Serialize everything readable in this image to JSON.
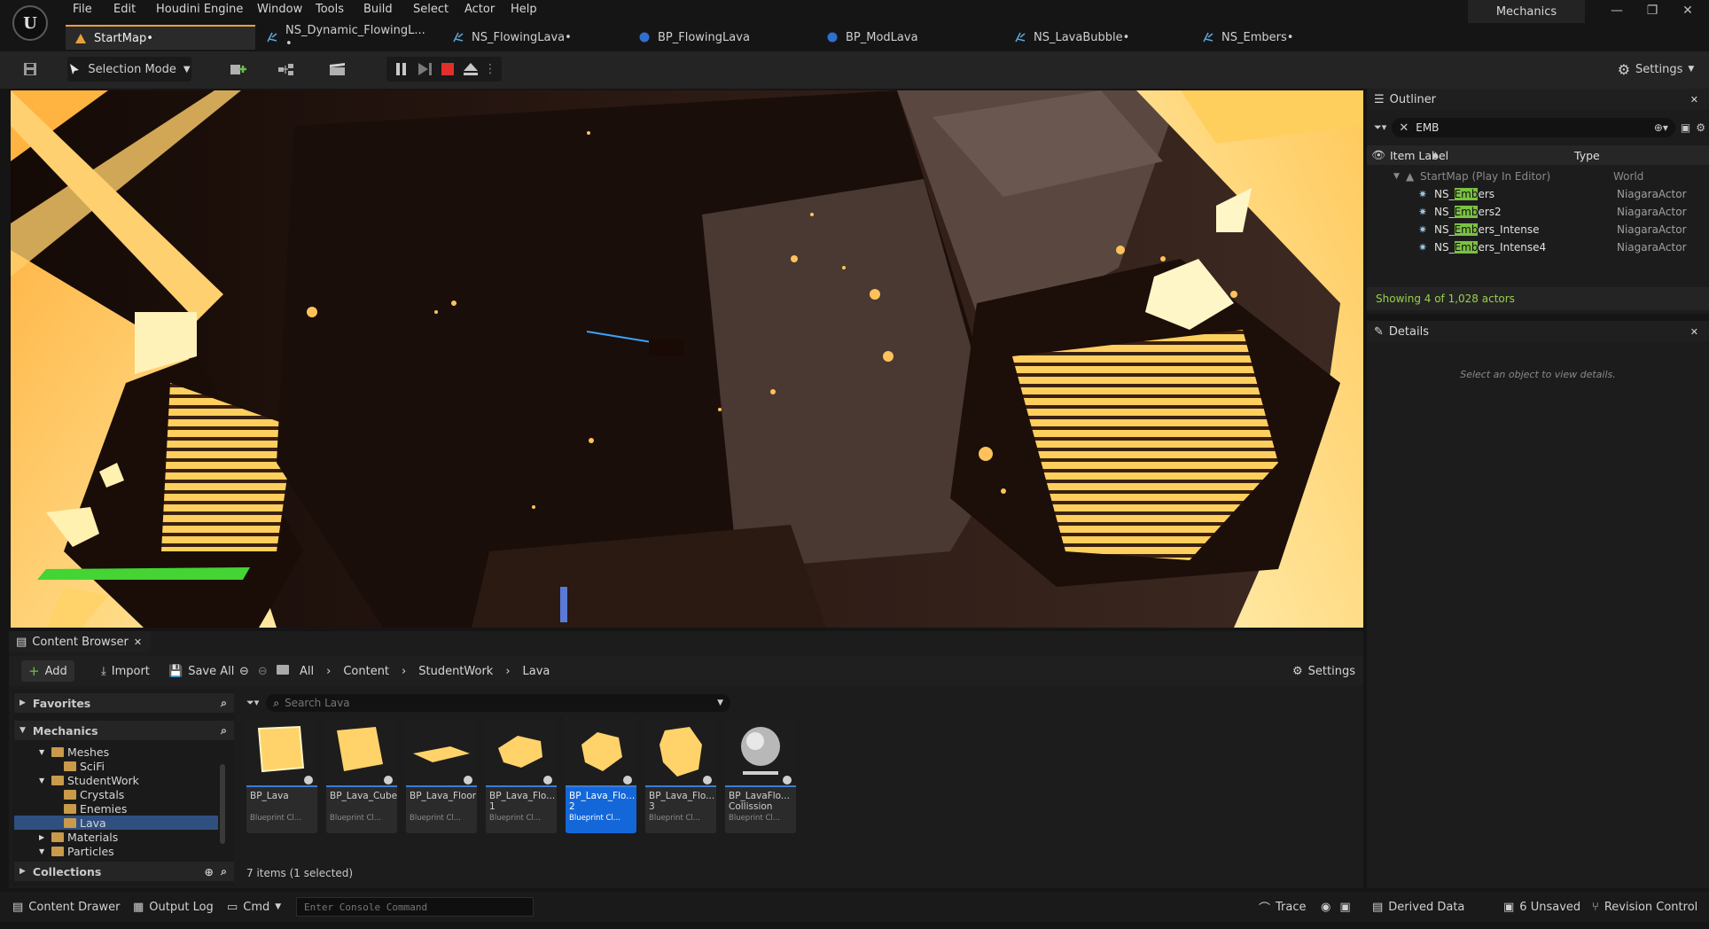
{
  "menu": [
    "File",
    "Edit",
    "Houdini Engine",
    "Window",
    "Tools",
    "Build",
    "Select",
    "Actor",
    "Help"
  ],
  "project_name": "Mechanics",
  "window_controls": [
    "—",
    "❐",
    "✕"
  ],
  "tabs": [
    {
      "label": "StartMap•",
      "active": true
    },
    {
      "label": "NS_Dynamic_FlowingL... •",
      "active": false
    },
    {
      "label": "NS_FlowingLava•",
      "active": false
    },
    {
      "label": "BP_FlowingLava",
      "active": false
    },
    {
      "label": "BP_ModLava",
      "active": false
    },
    {
      "label": "NS_LavaBubble•",
      "active": false
    },
    {
      "label": "NS_Embers•",
      "active": false
    }
  ],
  "toolbar": {
    "selection_mode": "Selection Mode",
    "settings": "Settings"
  },
  "outliner": {
    "tab": "Outliner",
    "search_value": "EMB",
    "col_label": "Item Label",
    "col_type": "Type",
    "root": {
      "label": "StartMap (Play In Editor)",
      "type": "World"
    },
    "highlight": "Emb",
    "items": [
      {
        "pre": "NS_",
        "hl": "Emb",
        "post": "ers",
        "type": "NiagaraActor"
      },
      {
        "pre": "NS_",
        "hl": "Emb",
        "post": "ers2",
        "type": "NiagaraActor"
      },
      {
        "pre": "NS_",
        "hl": "Emb",
        "post": "ers_Intense",
        "type": "NiagaraActor"
      },
      {
        "pre": "NS_",
        "hl": "Emb",
        "post": "ers_Intense4",
        "type": "NiagaraActor"
      }
    ],
    "status": "Showing 4 of 1,028 actors"
  },
  "details": {
    "tab": "Details",
    "empty_text": "Select an object to view details."
  },
  "content_browser": {
    "tab": "Content Browser",
    "add": "Add",
    "import": "Import",
    "save_all": "Save All",
    "breadcrumb": [
      "All",
      "Content",
      "StudentWork",
      "Lava"
    ],
    "settings": "Settings",
    "search_placeholder": "Search Lava",
    "favorites": "Favorites",
    "mechanics": "Mechanics",
    "collections": "Collections",
    "tree": [
      {
        "label": "Meshes",
        "indent": 2,
        "expanded": true
      },
      {
        "label": "SciFi",
        "indent": 3,
        "expanded": false
      },
      {
        "label": "StudentWork",
        "indent": 2,
        "expanded": true
      },
      {
        "label": "Crystals",
        "indent": 3,
        "expanded": false
      },
      {
        "label": "Enemies",
        "indent": 3,
        "expanded": false
      },
      {
        "label": "Lava",
        "indent": 3,
        "expanded": false,
        "selected": true
      },
      {
        "label": "Materials",
        "indent": 2,
        "expanded": false
      },
      {
        "label": "Particles",
        "indent": 2,
        "expanded": true
      }
    ],
    "assets": [
      {
        "name": "BP_Lava",
        "type": "Blueprint Cl...",
        "shape": "cube"
      },
      {
        "name": "BP_Lava_Cube",
        "type": "Blueprint Cl...",
        "shape": "cube2"
      },
      {
        "name": "BP_Lava_Floor",
        "type": "Blueprint Cl...",
        "shape": "floor"
      },
      {
        "name": "BP_Lava_Flo... 1",
        "type": "Blueprint Cl...",
        "shape": "hex"
      },
      {
        "name": "BP_Lava_Flo... 2",
        "type": "Blueprint Cl...",
        "shape": "hex2",
        "selected": true
      },
      {
        "name": "BP_Lava_Flo... 3",
        "type": "Blueprint Cl...",
        "shape": "oct"
      },
      {
        "name": "BP_LavaFlo... Collission",
        "type": "Blueprint Cl...",
        "shape": "sphere"
      }
    ],
    "count": "7 items (1 selected)"
  },
  "statusbar": {
    "content_drawer": "Content Drawer",
    "output_log": "Output Log",
    "cmd": "Cmd",
    "console_placeholder": "Enter Console Command",
    "trace": "Trace",
    "derived_data": "Derived Data",
    "unsaved": "6 Unsaved",
    "revision_control": "Revision Control"
  },
  "colors": {
    "accent_orange": "#e8a13a",
    "selection_blue": "#1467d8",
    "search_highlight": "#7ac142",
    "lava": "#ffd56a"
  }
}
